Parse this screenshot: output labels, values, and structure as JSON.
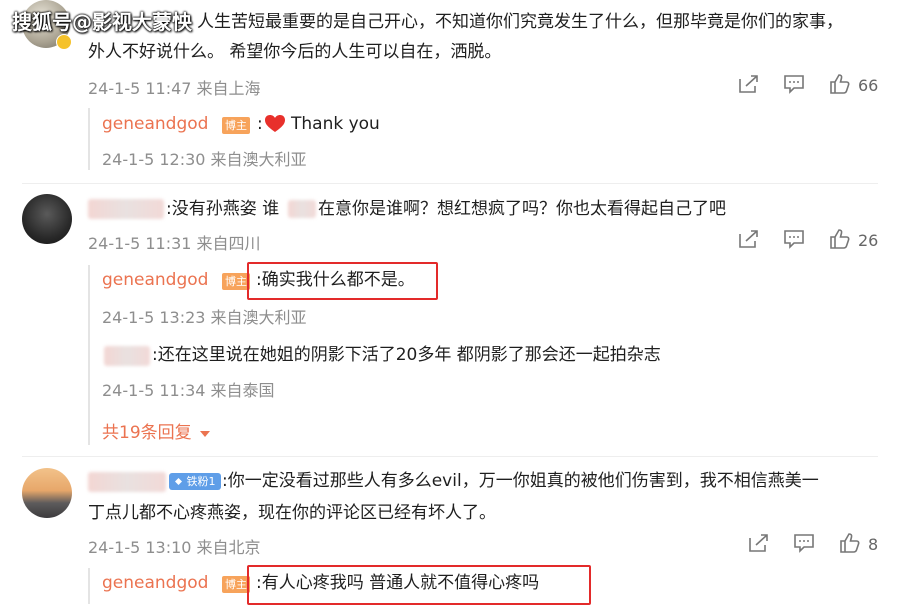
{
  "watermark": "搜狐号@影视大蒙怏",
  "comments": [
    {
      "text_line1": "人生苦短最重要的是自己开心，不知道你们究竟发生了什么，但那毕竟是你们的家事，",
      "text_line2": "外人不好说什么。 希望你今后的人生可以自在，洒脱。",
      "meta": "24-1-5 11:47 来自上海",
      "likes": "66",
      "reply": {
        "user": "geneandgod",
        "badge": "博主",
        "sep": ":",
        "text": "Thank you",
        "meta": "24-1-5 12:30 来自澳大利亚"
      }
    },
    {
      "text_prefix": ":没有孙燕姿 谁",
      "text_suffix": "在意你是谁啊？想红想疯了吗？你也太看得起自己了吧",
      "meta": "24-1-5 11:31 来自四川",
      "likes": "26",
      "reply": {
        "user": "geneandgod",
        "badge": "博主",
        "text": ":确实我什么都不是。",
        "meta": "24-1-5 13:23 来自澳大利亚"
      },
      "reply2": {
        "text": ":还在这里说在她姐的阴影下活了20多年 都阴影了那会还一起拍杂志",
        "meta": "24-1-5 11:34 来自泰国"
      },
      "expand_label": "共19条回复"
    },
    {
      "fan_badge": "铁粉1",
      "text_line1": ":你一定没看过那些人有多么evil，万一你姐真的被他们伤害到，我不相信燕美一",
      "text_line2": "丁点儿都不心疼燕姿，现在你的评论区已经有坏人了。",
      "meta": "24-1-5 13:10 来自北京",
      "likes": "8",
      "reply": {
        "user": "geneandgod",
        "badge": "博主",
        "text": ":有人心疼我吗 普通人就不值得心疼吗"
      }
    }
  ],
  "icons": [
    "share-icon",
    "comment-icon",
    "like-icon",
    "heart-icon",
    "triangle-down-icon",
    "fan-badge-icon"
  ],
  "colors": {
    "username": "#eb7350",
    "highlight_box": "#e32a2a",
    "meta": "#8e8e8e",
    "badge": "#f7a35b",
    "fan_badge": "#5f9ee8"
  }
}
